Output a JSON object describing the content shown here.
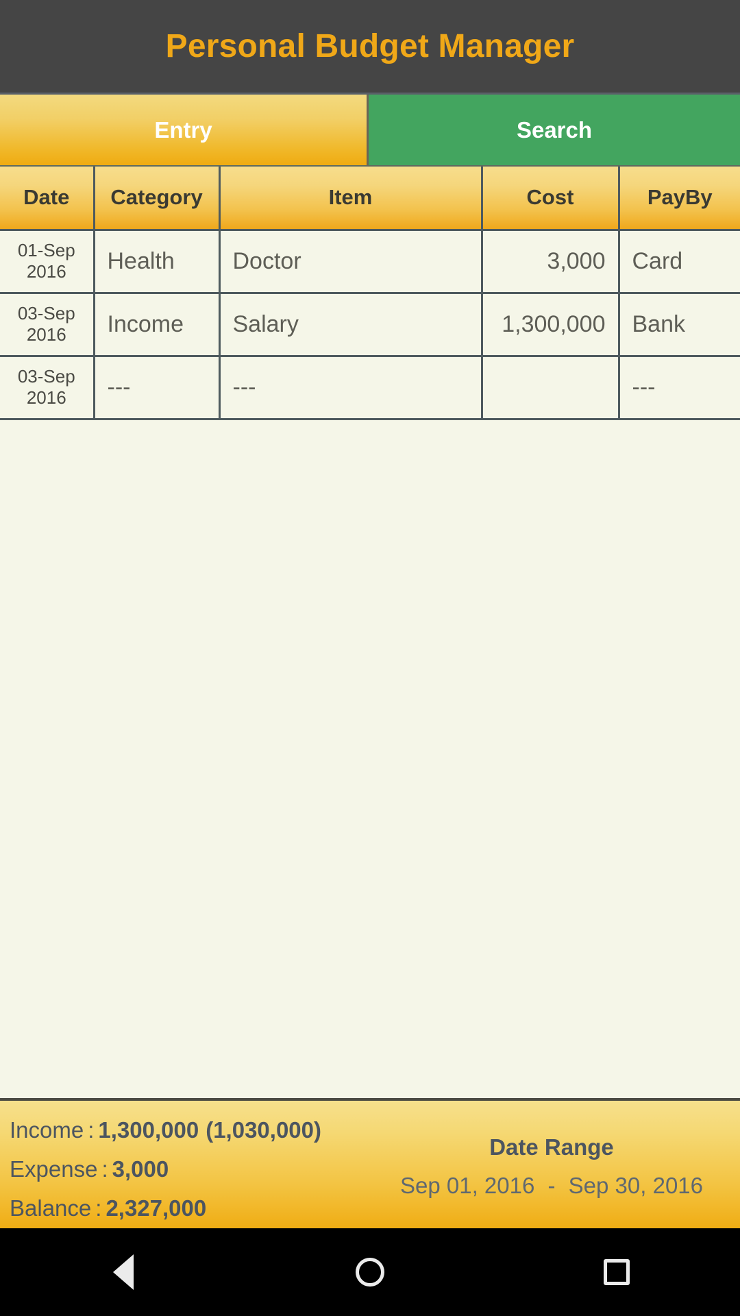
{
  "app": {
    "title": "Personal Budget Manager",
    "title_color": "#f0a818",
    "title_bar_color": "#454545"
  },
  "tabs": [
    {
      "id": "entry",
      "label": "Entry",
      "active": true,
      "color": "#f0b829"
    },
    {
      "id": "search",
      "label": "Search",
      "active": false,
      "color": "#43a55f"
    }
  ],
  "table": {
    "columns": [
      {
        "key": "date",
        "label": "Date"
      },
      {
        "key": "category",
        "label": "Category"
      },
      {
        "key": "item",
        "label": "Item"
      },
      {
        "key": "cost",
        "label": "Cost"
      },
      {
        "key": "payby",
        "label": "PayBy"
      }
    ],
    "rows": [
      {
        "date_day": "01-Sep",
        "date_year": "2016",
        "category": "Health",
        "item": "Doctor",
        "cost": "3,000",
        "payby": "Card"
      },
      {
        "date_day": "03-Sep",
        "date_year": "2016",
        "category": "Income",
        "item": "Salary",
        "cost": "1,300,000",
        "payby": "Bank"
      },
      {
        "date_day": "03-Sep",
        "date_year": "2016",
        "category": "---",
        "item": "---",
        "cost": "",
        "payby": "---"
      }
    ]
  },
  "summary": {
    "income_label": "Income",
    "income_colon": ":",
    "income_value": "1,300,000",
    "income_secondary": "(1,030,000)",
    "expense_label": "Expense",
    "expense_colon": ":",
    "expense_value": "3,000",
    "balance_label": "Balance",
    "balance_colon": ":",
    "balance_value": "2,327,000",
    "date_range_title": "Date Range",
    "date_range_start": "Sep 01, 2016",
    "date_range_separator": "-",
    "date_range_end": "Sep 30, 2016"
  },
  "nav_bar": {
    "back_icon": "back-triangle-icon",
    "home_icon": "home-circle-icon",
    "recents_icon": "recents-square-icon"
  }
}
